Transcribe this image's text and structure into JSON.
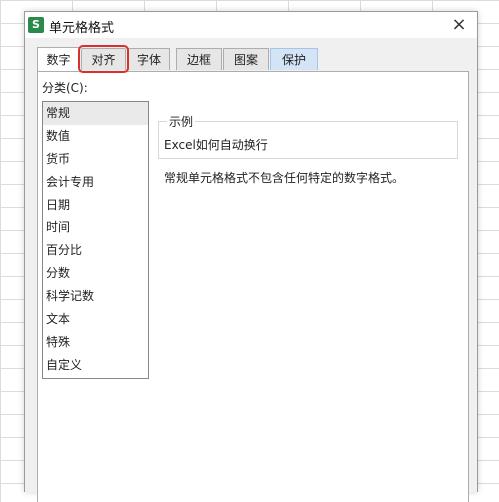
{
  "dialog": {
    "app_icon": "S",
    "title": "单元格格式",
    "close": "×"
  },
  "tabs": [
    {
      "label": "数字",
      "active": true
    },
    {
      "label": "对齐",
      "highlighted": true
    },
    {
      "label": "字体"
    },
    {
      "label": "边框"
    },
    {
      "label": "图案"
    },
    {
      "label": "保护"
    }
  ],
  "category": {
    "label": "分类(C):",
    "items": [
      "常规",
      "数值",
      "货币",
      "会计专用",
      "日期",
      "时间",
      "百分比",
      "分数",
      "科学记数",
      "文本",
      "特殊",
      "自定义"
    ],
    "selected": "常规"
  },
  "sample": {
    "legend": "示例",
    "value": "Excel如何自动换行"
  },
  "description": "常规单元格格式不包含任何特定的数字格式。",
  "colors": {
    "app_icon": "#2a8a4a",
    "highlight_box": "#d9302c",
    "protect_tab": "#d3e4f6"
  }
}
